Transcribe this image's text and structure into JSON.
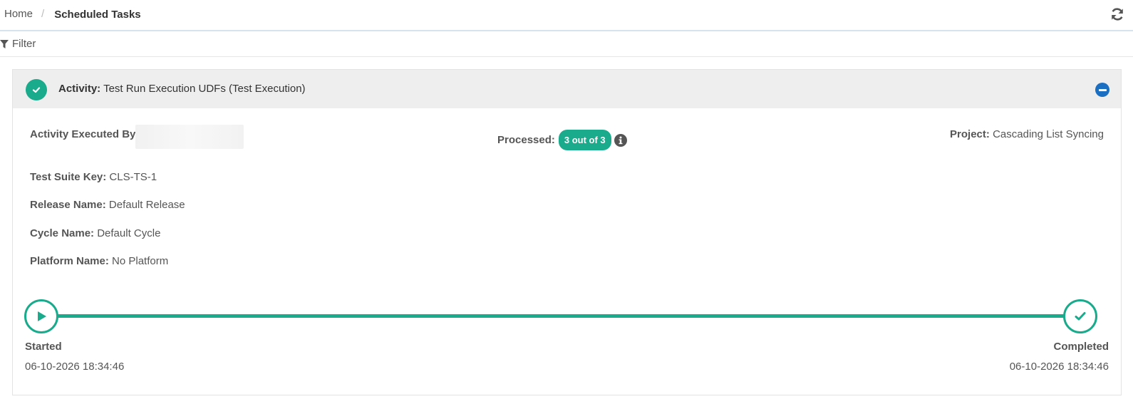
{
  "breadcrumb": {
    "home": "Home",
    "separator": "/",
    "current": "Scheduled Tasks"
  },
  "toolbar": {
    "refresh_icon": "refresh-icon"
  },
  "filter": {
    "label": "Filter",
    "icon": "filter-icon"
  },
  "activity": {
    "label": "Activity:",
    "name": "Test Run Execution UDFs (Test Execution)",
    "status_icon": "check-circle-icon",
    "collapse_icon": "minus-circle-icon",
    "executed_by_label": "Activity Executed By",
    "processed_label": "Processed:",
    "processed_badge": "3 out of 3",
    "project_label": "Project:",
    "project_value": "Cascading List Syncing",
    "fields": [
      {
        "label": "Test Suite Key:",
        "value": "CLS-TS-1"
      },
      {
        "label": "Release Name:",
        "value": "Default Release"
      },
      {
        "label": "Cycle Name:",
        "value": "Default Cycle"
      },
      {
        "label": "Platform Name:",
        "value": "No Platform"
      }
    ],
    "timeline": {
      "progress": 1.0,
      "start_label": "Started",
      "start_time": "06-10-2026 18:34:46",
      "end_label": "Completed",
      "end_time": "06-10-2026 18:34:46"
    }
  },
  "colors": {
    "accent": "#1aaa8c",
    "collapse": "#1b6fc2",
    "header_bg": "#eeeeee"
  }
}
